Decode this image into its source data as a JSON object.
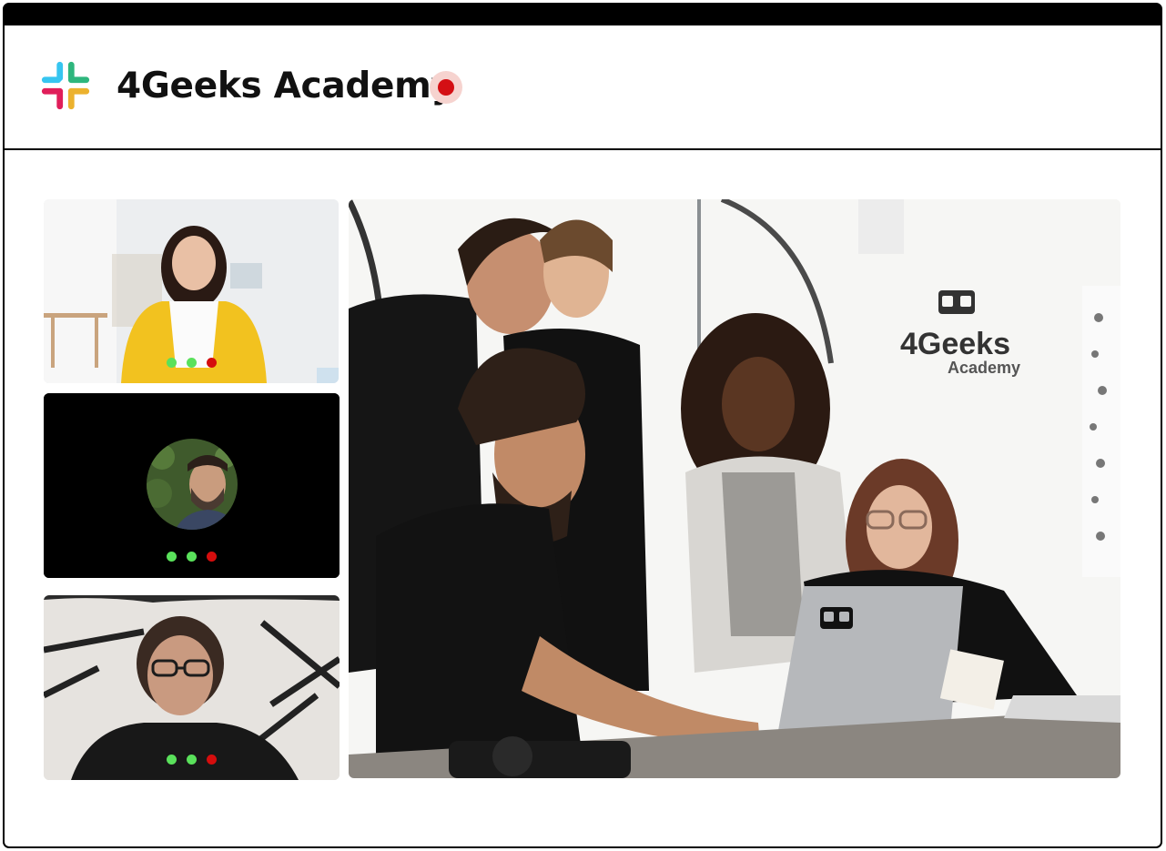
{
  "app": {
    "title": "4Geeks Academy",
    "recording": true
  },
  "icons": {
    "app_logo": "slack-logo-icon",
    "recording_indicator": "record-dot-icon"
  },
  "colors": {
    "frame": "#000000",
    "status_active": "#5ae15b",
    "status_end": "#d50d0d",
    "record": "#d40f14",
    "record_halo": "#f6d3cf"
  },
  "participants": [
    {
      "video": "on",
      "description": "woman in yellow jacket",
      "status_dots": [
        "active",
        "active",
        "end"
      ]
    },
    {
      "video": "off",
      "avatar": "circular profile photo",
      "status_dots": [
        "active",
        "active",
        "end"
      ]
    },
    {
      "video": "on",
      "description": "woman with glasses",
      "status_dots": [
        "active",
        "active",
        "end"
      ]
    }
  ],
  "main_stage": {
    "video": "on",
    "wall_logo_lines": [
      "4Geeks",
      "Academy"
    ]
  }
}
